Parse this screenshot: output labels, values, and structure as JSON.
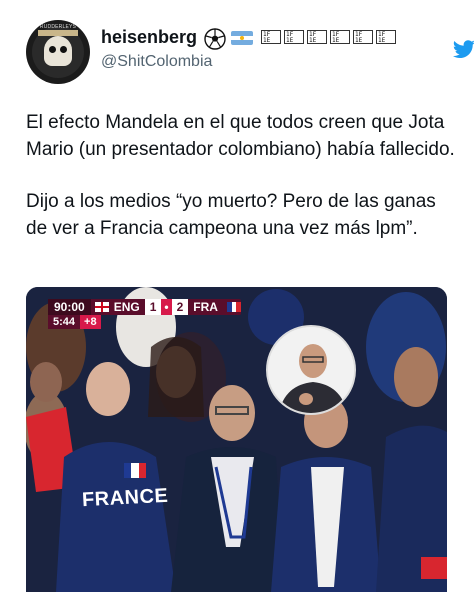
{
  "tweet": {
    "display_name": "heisenberg",
    "handle": "@ShitColombia",
    "avatar_text": "RUDDERLEYS",
    "name_glyphs": [
      "1F 1E 1F 1E 1F",
      "1F 1E 1F 1E 1F",
      "1F 1E 1F 1E",
      "1F 1E 1F 1E 1F",
      "1F 1E 1F 1E 1F",
      "1F 1E 1F 1E 1F"
    ],
    "paragraph_1": "El efecto Mandela en el que todos creen que Jota Mario (un presentador colombiano) había fallecido.",
    "paragraph_2": "Dijo a los medios “yo muerto? Pero de las ganas de ver a Francia campeona una vez más lpm”."
  },
  "icons": {
    "soccer": "soccer-ball-icon",
    "flag": "argentina-flag-icon",
    "platform": "twitter-bird-icon"
  },
  "media": {
    "scoreboard": {
      "clock": "90:00",
      "team_home": "ENG",
      "score_home": "1",
      "score_away": "2",
      "team_away": "FRA",
      "sub_clock": "5:44",
      "added_time": "+8"
    },
    "shirt_text": "FRANCE"
  },
  "colors": {
    "twitter_blue": "#1d9bf0",
    "scoreboard_maroon": "#5a0d2b",
    "france_blue": "#1c2f6b"
  }
}
